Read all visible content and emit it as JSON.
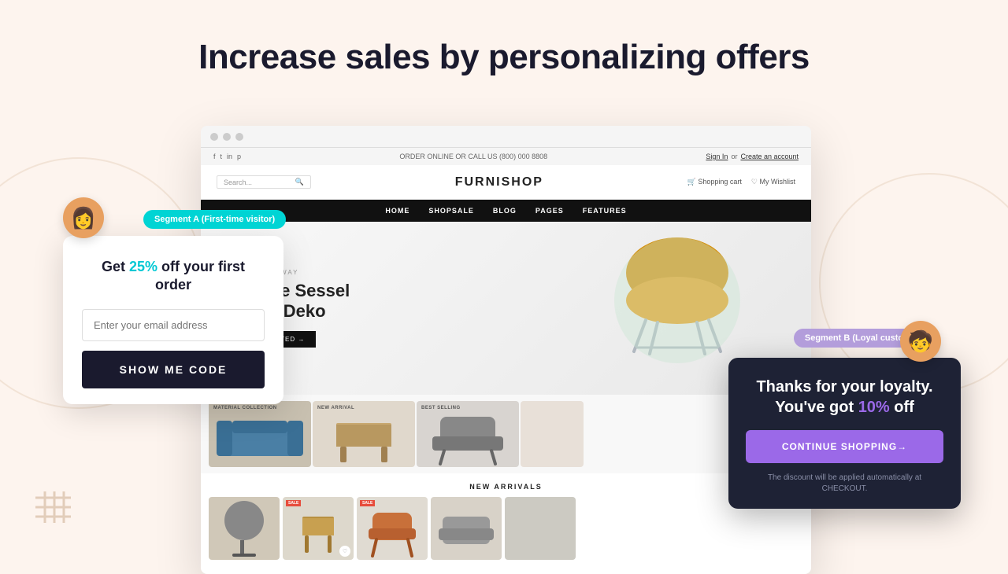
{
  "page": {
    "bg_color": "#fdf4ee",
    "heading": "Increase sales by personalizing offers"
  },
  "furnishop": {
    "announcement": {
      "left": "ORDER ONLINE OR CALL US (800) 000 8808",
      "right_sign_in": "Sign In",
      "right_or": "or",
      "right_create": "Create an account"
    },
    "logo": "FURNISHOP",
    "search_placeholder": "Search...",
    "actions": [
      "Shopping cart",
      "My Wishlist"
    ],
    "nav_items": [
      "HOME",
      "SHOPSALE",
      "BLOG",
      "PAGES",
      "FEATURES"
    ],
    "hero": {
      "subtitle": "THE HARD WAY",
      "title_line1": "oderne Sessel",
      "title_line2": "eutch Deko",
      "cta": "GET STARTED →"
    },
    "products": [
      {
        "label": "MATERIAL\nCOLLECTION"
      },
      {
        "label": "NEW\nARRIVAL"
      },
      {
        "label": "BEST\nSELLING"
      }
    ],
    "new_arrivals_title": "NEW ARRIVALS"
  },
  "segment_a": {
    "label": "Segment A (First-time visitor)",
    "avatar_emoji": "👩",
    "popup": {
      "title_part1": "Get ",
      "discount": "25%",
      "title_part2": " off your first order",
      "email_placeholder": "Enter your email address",
      "cta_button": "SHOW ME CODE"
    }
  },
  "segment_b": {
    "label": "Segment B (Loyal customer)",
    "avatar_emoji": "🧒",
    "popup": {
      "title_line1": "Thanks for your loyalty.",
      "title_part1": "You've got ",
      "discount": "10%",
      "title_part2": " off",
      "cta_button": "CONTINUE SHOPPING→",
      "footer": "The discount will be applied automatically at CHECKOUT."
    }
  },
  "decorative": {
    "hash_icon": "≡"
  }
}
